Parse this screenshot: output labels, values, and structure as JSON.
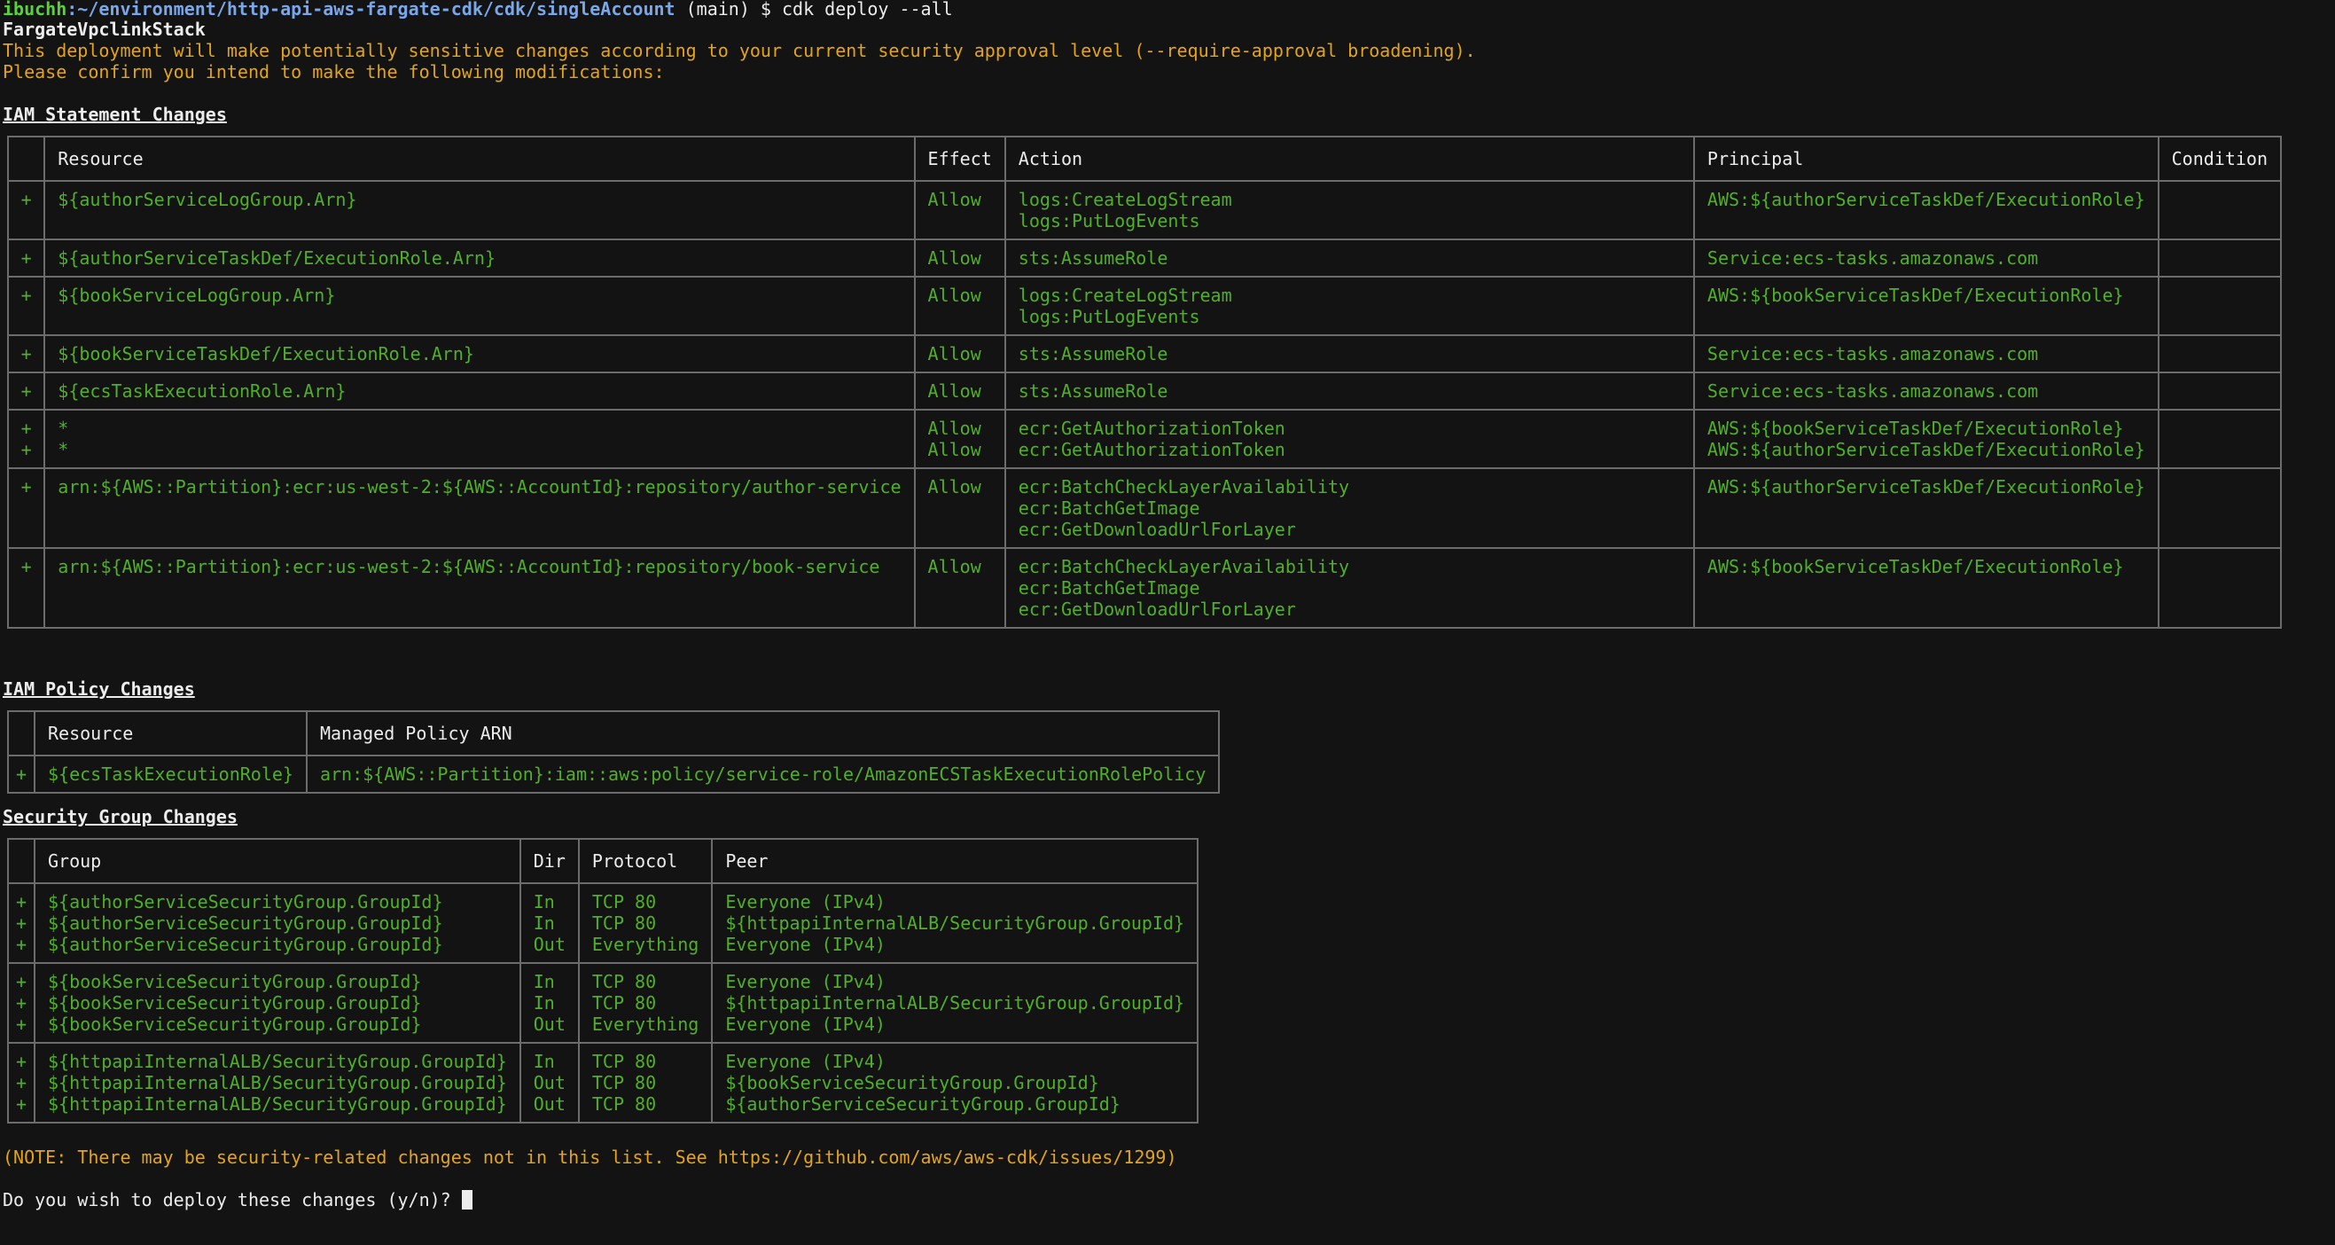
{
  "prompt": {
    "user": "ibuchh",
    "path": "~/environment/http-api-aws-fargate-cdk/cdk/singleAccount",
    "branch": " (main) ",
    "command": "$ cdk deploy --all"
  },
  "stack_name": "FargateVpclinkStack",
  "warning_line1": "This deployment will make potentially sensitive changes according to your current security approval level (--require-approval broadening).",
  "warning_line2": "Please confirm you intend to make the following modifications:",
  "iam_statements": {
    "title": "IAM Statement Changes",
    "headers": [
      "",
      "Resource",
      "Effect",
      "Action",
      "Principal",
      "Condition"
    ],
    "rows": [
      {
        "plus": "+",
        "resource": "${authorServiceLogGroup.Arn}",
        "effect": "Allow",
        "action": "logs:CreateLogStream\nlogs:PutLogEvents",
        "principal": "AWS:${authorServiceTaskDef/ExecutionRole}",
        "condition": ""
      },
      {
        "plus": "+",
        "resource": "${authorServiceTaskDef/ExecutionRole.Arn}",
        "effect": "Allow",
        "action": "sts:AssumeRole",
        "principal": "Service:ecs-tasks.amazonaws.com",
        "condition": ""
      },
      {
        "plus": "+",
        "resource": "${bookServiceLogGroup.Arn}",
        "effect": "Allow",
        "action": "logs:CreateLogStream\nlogs:PutLogEvents",
        "principal": "AWS:${bookServiceTaskDef/ExecutionRole}",
        "condition": ""
      },
      {
        "plus": "+",
        "resource": "${bookServiceTaskDef/ExecutionRole.Arn}",
        "effect": "Allow",
        "action": "sts:AssumeRole",
        "principal": "Service:ecs-tasks.amazonaws.com",
        "condition": ""
      },
      {
        "plus": "+",
        "resource": "${ecsTaskExecutionRole.Arn}",
        "effect": "Allow",
        "action": "sts:AssumeRole",
        "principal": "Service:ecs-tasks.amazonaws.com",
        "condition": ""
      },
      {
        "plus": "+\n+",
        "resource": "*\n*",
        "effect": "Allow\nAllow",
        "action": "ecr:GetAuthorizationToken\necr:GetAuthorizationToken",
        "principal": "AWS:${bookServiceTaskDef/ExecutionRole}\nAWS:${authorServiceTaskDef/ExecutionRole}",
        "condition": ""
      },
      {
        "plus": "+",
        "resource": "arn:${AWS::Partition}:ecr:us-west-2:${AWS::AccountId}:repository/author-service",
        "effect": "Allow",
        "action": "ecr:BatchCheckLayerAvailability\necr:BatchGetImage\necr:GetDownloadUrlForLayer",
        "principal": "AWS:${authorServiceTaskDef/ExecutionRole}",
        "condition": ""
      },
      {
        "plus": "+",
        "resource": "arn:${AWS::Partition}:ecr:us-west-2:${AWS::AccountId}:repository/book-service",
        "effect": "Allow",
        "action": "ecr:BatchCheckLayerAvailability\necr:BatchGetImage\necr:GetDownloadUrlForLayer",
        "principal": "AWS:${bookServiceTaskDef/ExecutionRole}",
        "condition": ""
      }
    ]
  },
  "iam_policies": {
    "title": "IAM Policy Changes",
    "headers": [
      "",
      "Resource",
      "Managed Policy ARN"
    ],
    "rows": [
      {
        "plus": "+",
        "resource": "${ecsTaskExecutionRole}",
        "arn": "arn:${AWS::Partition}:iam::aws:policy/service-role/AmazonECSTaskExecutionRolePolicy"
      }
    ]
  },
  "security_groups": {
    "title": "Security Group Changes",
    "headers": [
      "",
      "Group",
      "Dir",
      "Protocol",
      "Peer"
    ],
    "rows": [
      {
        "plus": "+\n+\n+",
        "group": "${authorServiceSecurityGroup.GroupId}\n${authorServiceSecurityGroup.GroupId}\n${authorServiceSecurityGroup.GroupId}",
        "dir": "In\nIn\nOut",
        "protocol": "TCP 80\nTCP 80\nEverything",
        "peer": "Everyone (IPv4)\n${httpapiInternalALB/SecurityGroup.GroupId}\nEveryone (IPv4)"
      },
      {
        "plus": "+\n+\n+",
        "group": "${bookServiceSecurityGroup.GroupId}\n${bookServiceSecurityGroup.GroupId}\n${bookServiceSecurityGroup.GroupId}",
        "dir": "In\nIn\nOut",
        "protocol": "TCP 80\nTCP 80\nEverything",
        "peer": "Everyone (IPv4)\n${httpapiInternalALB/SecurityGroup.GroupId}\nEveryone (IPv4)"
      },
      {
        "plus": "+\n+\n+",
        "group": "${httpapiInternalALB/SecurityGroup.GroupId}\n${httpapiInternalALB/SecurityGroup.GroupId}\n${httpapiInternalALB/SecurityGroup.GroupId}",
        "dir": "In\nOut\nOut",
        "protocol": "TCP 80\nTCP 80\nTCP 80",
        "peer": "Everyone (IPv4)\n${bookServiceSecurityGroup.GroupId}\n${authorServiceSecurityGroup.GroupId}"
      }
    ]
  },
  "note": "(NOTE: There may be security-related changes not in this list. See https://github.com/aws/aws-cdk/issues/1299)",
  "confirm_prompt": "Do you wish to deploy these changes (y/n)? ",
  "colors": {
    "background": "#131313",
    "green": "#4fb027",
    "yellow": "#e3a41a",
    "path": "#7aa7e8",
    "border": "#6c6c6c"
  }
}
